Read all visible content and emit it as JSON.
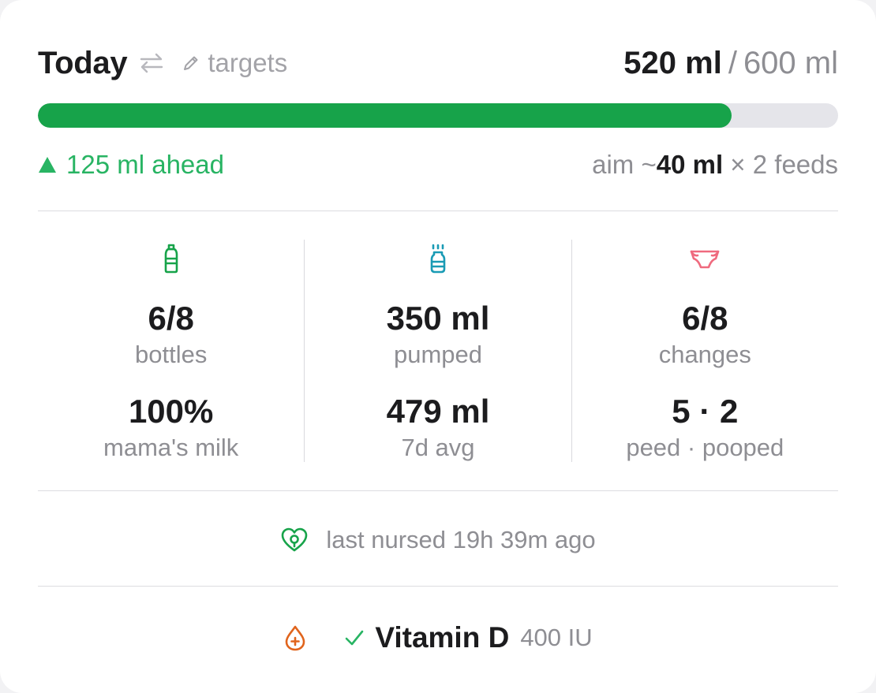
{
  "header": {
    "title": "Today",
    "targets_label": "targets",
    "total_current": "520 ml",
    "total_separator": "/",
    "total_target": "600 ml"
  },
  "progress": {
    "fraction": 0.867,
    "color": "#17a34a"
  },
  "status": {
    "ahead_text": "125 ml ahead",
    "aim_prefix": "aim ~",
    "aim_amount": "40 ml",
    "aim_suffix": " × 2 feeds"
  },
  "stats": [
    {
      "icon": "bottle-icon",
      "value": "6/8",
      "label": "bottles",
      "value2": "100%",
      "label2": "mama's milk"
    },
    {
      "icon": "pump-icon",
      "value": "350 ml",
      "label": "pumped",
      "value2": "479 ml",
      "label2": "7d avg"
    },
    {
      "icon": "diaper-icon",
      "value": "6/8",
      "label": "changes",
      "value2": "5 · 2",
      "label2": "peed · pooped"
    }
  ],
  "nursing": {
    "text": "last nursed 19h 39m ago"
  },
  "supplement": {
    "name": "Vitamin D",
    "dose": "400 IU",
    "taken": true
  },
  "colors": {
    "green": "#17a34a",
    "teal": "#1a9bb5",
    "pink": "#ef6a7e",
    "orange": "#e0641c"
  }
}
